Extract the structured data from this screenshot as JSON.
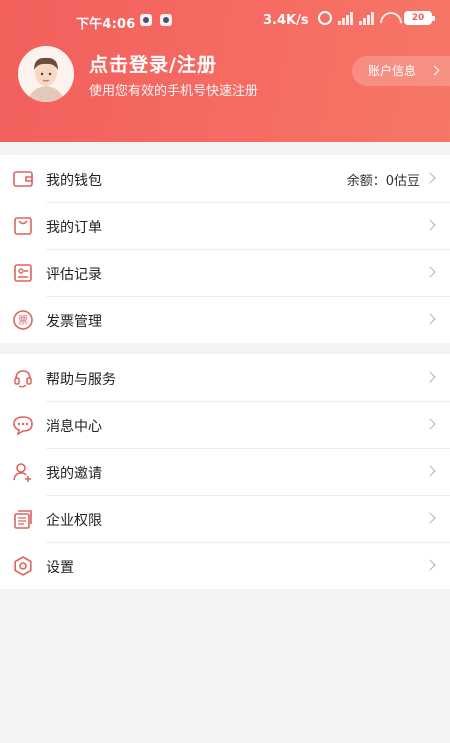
{
  "statusbar": {
    "time": "下午4:06",
    "speed": "3.4K/s",
    "battery": "20"
  },
  "profile": {
    "login_title": "点击登录/注册",
    "login_sub": "使用您有效的手机号快速注册",
    "account_label": "账户信息"
  },
  "colors": {
    "accent": "#f25f5c",
    "icon": "#e0635c"
  },
  "menu1": [
    {
      "label": "我的钱包",
      "value": "余额：0估豆",
      "icon": "wallet-icon"
    },
    {
      "label": "我的订单",
      "icon": "bag-icon"
    },
    {
      "label": "评估记录",
      "icon": "record-icon"
    },
    {
      "label": "发票管理",
      "icon": "invoice-icon"
    }
  ],
  "menu2": [
    {
      "label": "帮助与服务",
      "icon": "headset-icon"
    },
    {
      "label": "消息中心",
      "icon": "chat-icon"
    },
    {
      "label": "我的邀请",
      "icon": "invite-user-icon"
    },
    {
      "label": "企业权限",
      "icon": "enterprise-icon"
    },
    {
      "label": "设置",
      "icon": "settings-icon"
    }
  ]
}
